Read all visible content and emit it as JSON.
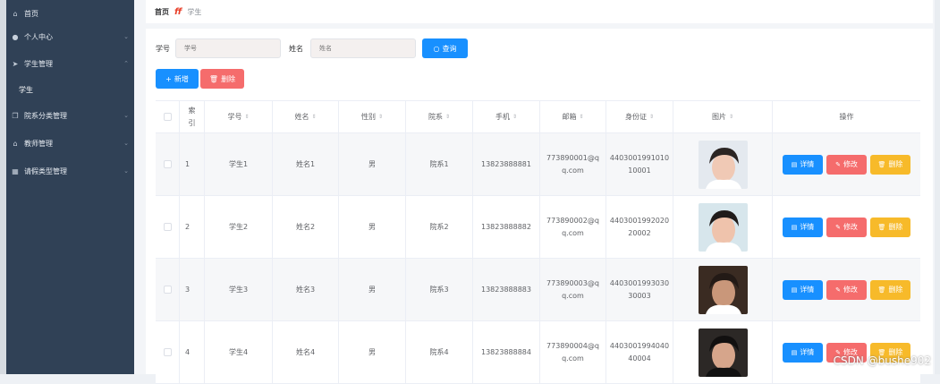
{
  "sidebar": {
    "items": [
      {
        "label": "首页",
        "icon": "home-icon",
        "has_chevron": false
      },
      {
        "label": "个人中心",
        "icon": "user-icon",
        "has_chevron": true
      },
      {
        "label": "学生管理",
        "icon": "send-icon",
        "has_chevron": true
      },
      {
        "label": "学生",
        "icon": "",
        "has_chevron": false
      },
      {
        "label": "院系分类管理",
        "icon": "copy-icon",
        "has_chevron": true
      },
      {
        "label": "教师管理",
        "icon": "bank-icon",
        "has_chevron": true
      },
      {
        "label": "请假类型管理",
        "icon": "grid-icon",
        "has_chevron": true
      }
    ]
  },
  "breadcrumb": {
    "home": "首页",
    "separator": "ff",
    "current": "学生"
  },
  "search": {
    "student_id_label": "学号",
    "student_id_placeholder": "学号",
    "name_label": "姓名",
    "name_placeholder": "姓名",
    "query_label": "查询"
  },
  "actions": {
    "add_label": "新增",
    "delete_label": "删除"
  },
  "table": {
    "headers": {
      "index": "索\n引",
      "student_id": "学号",
      "name": "姓名",
      "gender": "性别",
      "department": "院系",
      "phone": "手机",
      "email": "邮箱",
      "id_card": "身份证",
      "photo": "图片",
      "operations": "操作"
    },
    "row_buttons": {
      "detail": "详情",
      "edit": "修改",
      "delete": "删除"
    },
    "rows": [
      {
        "index": "1",
        "student_id": "学生1",
        "name": "姓名1",
        "gender": "男",
        "department": "院系1",
        "phone": "13823888881",
        "email": "773890001@q\nq.com",
        "id_card": "4403001991010\n10001"
      },
      {
        "index": "2",
        "student_id": "学生2",
        "name": "姓名2",
        "gender": "男",
        "department": "院系2",
        "phone": "13823888882",
        "email": "773890002@q\nq.com",
        "id_card": "4403001992020\n20002"
      },
      {
        "index": "3",
        "student_id": "学生3",
        "name": "姓名3",
        "gender": "男",
        "department": "院系3",
        "phone": "13823888883",
        "email": "773890003@q\nq.com",
        "id_card": "4403001993030\n30003"
      },
      {
        "index": "4",
        "student_id": "学生4",
        "name": "姓名4",
        "gender": "男",
        "department": "院系4",
        "phone": "13823888884",
        "email": "773890004@q\nq.com",
        "id_card": "4403001994040\n40004"
      }
    ]
  },
  "watermark": "CSDN @bushe902",
  "colors": {
    "sidebar_bg": "#304156",
    "primary": "#1890ff",
    "danger": "#f56c6c",
    "warning": "#f7ba2a"
  }
}
